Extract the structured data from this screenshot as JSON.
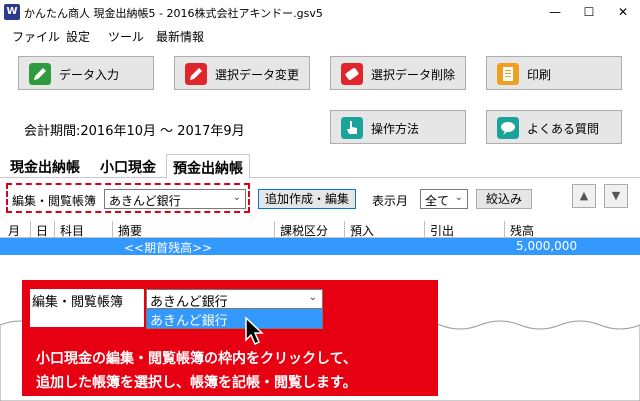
{
  "window": {
    "title": "かんたん商人 現金出納帳5 - 2016株式会社アキンドー.gsv5",
    "app_icon": "app-logo-icon",
    "controls": {
      "minimize": "—",
      "maximize": "☐",
      "close": "✕"
    }
  },
  "menu": [
    "ファイル",
    "設定",
    "ツール",
    "最新情報"
  ],
  "buttons": [
    {
      "label": "データ入力",
      "icon": "pencil-icon",
      "color": "#2e9b3e"
    },
    {
      "label": "選択データ変更",
      "icon": "edit-pencil-icon",
      "color": "#e0262d"
    },
    {
      "label": "選択データ削除",
      "icon": "eraser-icon",
      "color": "#e0262d"
    },
    {
      "label": "印刷",
      "icon": "print-icon",
      "color": "#f0a020"
    },
    {
      "label": "操作方法",
      "icon": "hand-pointer-icon",
      "color": "#1aa39a"
    },
    {
      "label": "よくある質問",
      "icon": "speech-bubble-icon",
      "color": "#1aa39a"
    }
  ],
  "period": "会計期間:2016年10月 〜 2017年9月",
  "tabs": [
    "現金出納帳",
    "小口現金",
    "預金出納帳"
  ],
  "active_tab": "預金出納帳",
  "filter": {
    "book_label": "編集・閲覧帳簿",
    "book_value": "あきんど銀行",
    "add_edit_button": "追加作成・編集",
    "month_label": "表示月",
    "month_value": "全て",
    "narrow_button": "絞込み",
    "up_arrow": "▲",
    "down_arrow": "▼"
  },
  "table": {
    "columns": [
      "月",
      "日",
      "科目",
      "摘要",
      "課税区分",
      "預入",
      "引出",
      "残高"
    ],
    "rows": [
      {
        "summary": "<<期首残高>>",
        "balance": "5,000,000"
      }
    ]
  },
  "guide": {
    "book_label": "編集・閲覧帳簿",
    "combo_value": "あきんど銀行",
    "option": "あきんど銀行",
    "line1": "小口現金の編集・閲覧帳簿の枠内をクリックして、",
    "line2": "追加した帳簿を選択し、帳簿を記帳・閲覧します。"
  },
  "colors": {
    "accent_red": "#e60012",
    "selection_blue": "#3399ff",
    "dashed_border": "#d9001b"
  }
}
